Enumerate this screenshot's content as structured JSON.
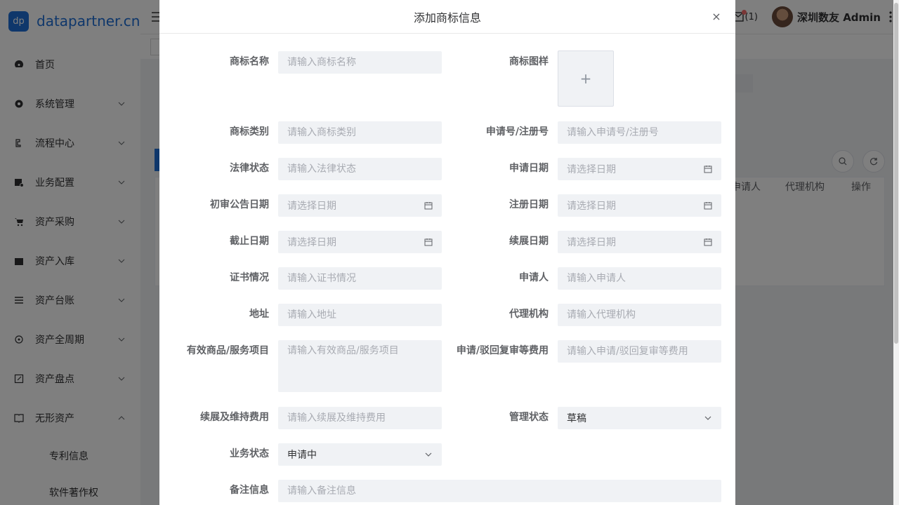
{
  "sidebar": {
    "logo_badge": "dp",
    "logo_text": "datapartner.cn",
    "items": [
      {
        "label": "首页",
        "icon": "dashboard-icon"
      },
      {
        "label": "系统管理",
        "icon": "gear-icon"
      },
      {
        "label": "流程中心",
        "icon": "flow-icon"
      },
      {
        "label": "业务配置",
        "icon": "config-icon"
      },
      {
        "label": "资产采购",
        "icon": "cart-icon"
      },
      {
        "label": "资产入库",
        "icon": "clapper-icon"
      },
      {
        "label": "资产台账",
        "icon": "list-icon"
      },
      {
        "label": "资产全周期",
        "icon": "cycle-icon"
      },
      {
        "label": "资产盘点",
        "icon": "edit-icon"
      },
      {
        "label": "无形资产",
        "icon": "book-icon"
      }
    ],
    "sub_items": [
      "专利信息",
      "软件著作权"
    ]
  },
  "header": {
    "msg_count": "(1)",
    "username": "深圳数友 Admin"
  },
  "background_table": {
    "columns": [
      "申请人",
      "代理机构",
      "操作"
    ]
  },
  "dialog": {
    "title": "添加商标信息",
    "close": "×",
    "upload_plus": "+",
    "fields": {
      "name": {
        "label": "商标名称",
        "placeholder": "请输入商标名称"
      },
      "image": {
        "label": "商标图样"
      },
      "category": {
        "label": "商标类别",
        "placeholder": "请输入商标类别"
      },
      "app_no": {
        "label": "申请号/注册号",
        "placeholder": "请输入申请号/注册号"
      },
      "legal": {
        "label": "法律状态",
        "placeholder": "请输入法律状态"
      },
      "app_date": {
        "label": "申请日期",
        "placeholder": "请选择日期"
      },
      "pre_date": {
        "label": "初审公告日期",
        "placeholder": "请选择日期"
      },
      "reg_date": {
        "label": "注册日期",
        "placeholder": "请选择日期"
      },
      "end_date": {
        "label": "截止日期",
        "placeholder": "请选择日期"
      },
      "renew_date": {
        "label": "续展日期",
        "placeholder": "请选择日期"
      },
      "cert": {
        "label": "证书情况",
        "placeholder": "请输入证书情况"
      },
      "applicant": {
        "label": "申请人",
        "placeholder": "请输入申请人"
      },
      "address": {
        "label": "地址",
        "placeholder": "请输入地址"
      },
      "agency": {
        "label": "代理机构",
        "placeholder": "请输入代理机构"
      },
      "goods": {
        "label": "有效商品/服务项目",
        "placeholder": "请输入有效商品/服务项目"
      },
      "review_fee": {
        "label": "申请/驳回复审等费用",
        "placeholder": "请输入申请/驳回复审等费用"
      },
      "renew_fee": {
        "label": "续展及维持费用",
        "placeholder": "请输入续展及维持费用"
      },
      "mgmt_status": {
        "label": "管理状态",
        "value": "草稿"
      },
      "biz_status": {
        "label": "业务状态",
        "value": "申请中"
      },
      "remark": {
        "label": "备注信息",
        "placeholder": "请输入备注信息"
      }
    }
  }
}
